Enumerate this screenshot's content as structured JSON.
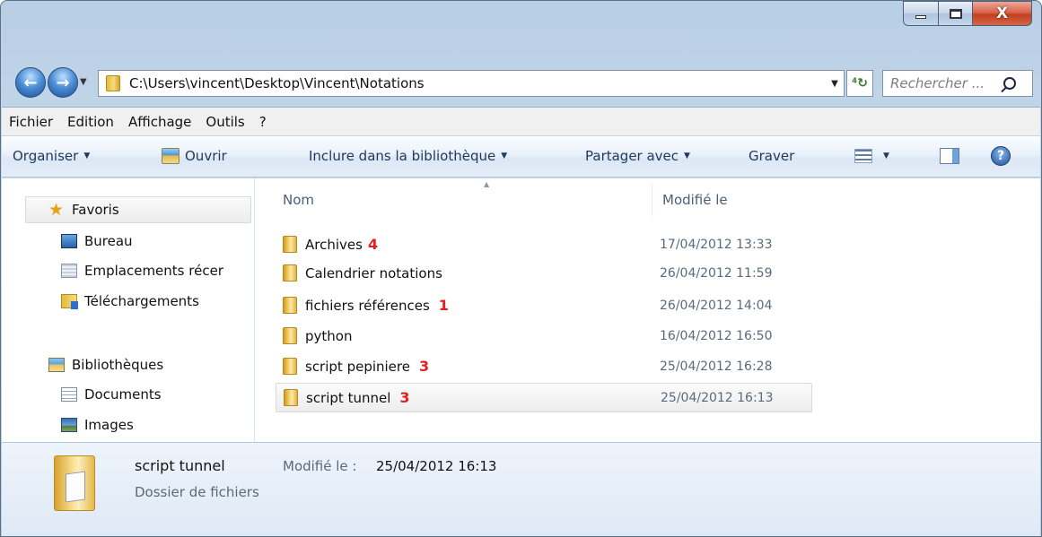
{
  "window": {
    "caption_buttons": {
      "minimize": "–",
      "maximize": "□",
      "close": "X"
    }
  },
  "nav": {
    "back_label": "←",
    "forward_label": "→",
    "history_dropdown": "▼",
    "address": "C:\\Users\\vincent\\Desktop\\Vincent\\Notations",
    "address_dropdown": "▼",
    "refresh_label": "⁴↻",
    "search_placeholder": "Rechercher ..."
  },
  "menubar": [
    "Fichier",
    "Edition",
    "Affichage",
    "Outils",
    "?"
  ],
  "commandbar": {
    "organiser": "Organiser",
    "ouvrir": "Ouvrir",
    "inclure": "Inclure dans la bibliothèque",
    "partager": "Partager avec",
    "graver": "Graver",
    "help": "?"
  },
  "sidebar": {
    "favoris": {
      "label": "Favoris",
      "children": [
        "Bureau",
        "Emplacements récer",
        "Téléchargements"
      ]
    },
    "bibliotheques": {
      "label": "Bibliothèques",
      "children": [
        "Documents",
        "Images"
      ]
    }
  },
  "columns": {
    "name": "Nom",
    "modified": "Modifié le"
  },
  "files": [
    {
      "name": "Archives",
      "badge": "4",
      "modified": "17/04/2012 13:33"
    },
    {
      "name": "Calendrier notations",
      "badge": "",
      "modified": "26/04/2012 11:59"
    },
    {
      "name": "fichiers références",
      "badge": "1",
      "modified": "26/04/2012 14:04"
    },
    {
      "name": "python",
      "badge": "",
      "modified": "16/04/2012 16:50"
    },
    {
      "name": "script pepiniere",
      "badge": "3",
      "modified": "25/04/2012 16:28"
    },
    {
      "name": "script tunnel",
      "badge": "3",
      "modified": "25/04/2012 16:13",
      "selected": true
    }
  ],
  "details": {
    "name": "script tunnel",
    "type": "Dossier de fichiers",
    "modified_label": "Modifié le :",
    "modified_value": "25/04/2012 16:13"
  }
}
